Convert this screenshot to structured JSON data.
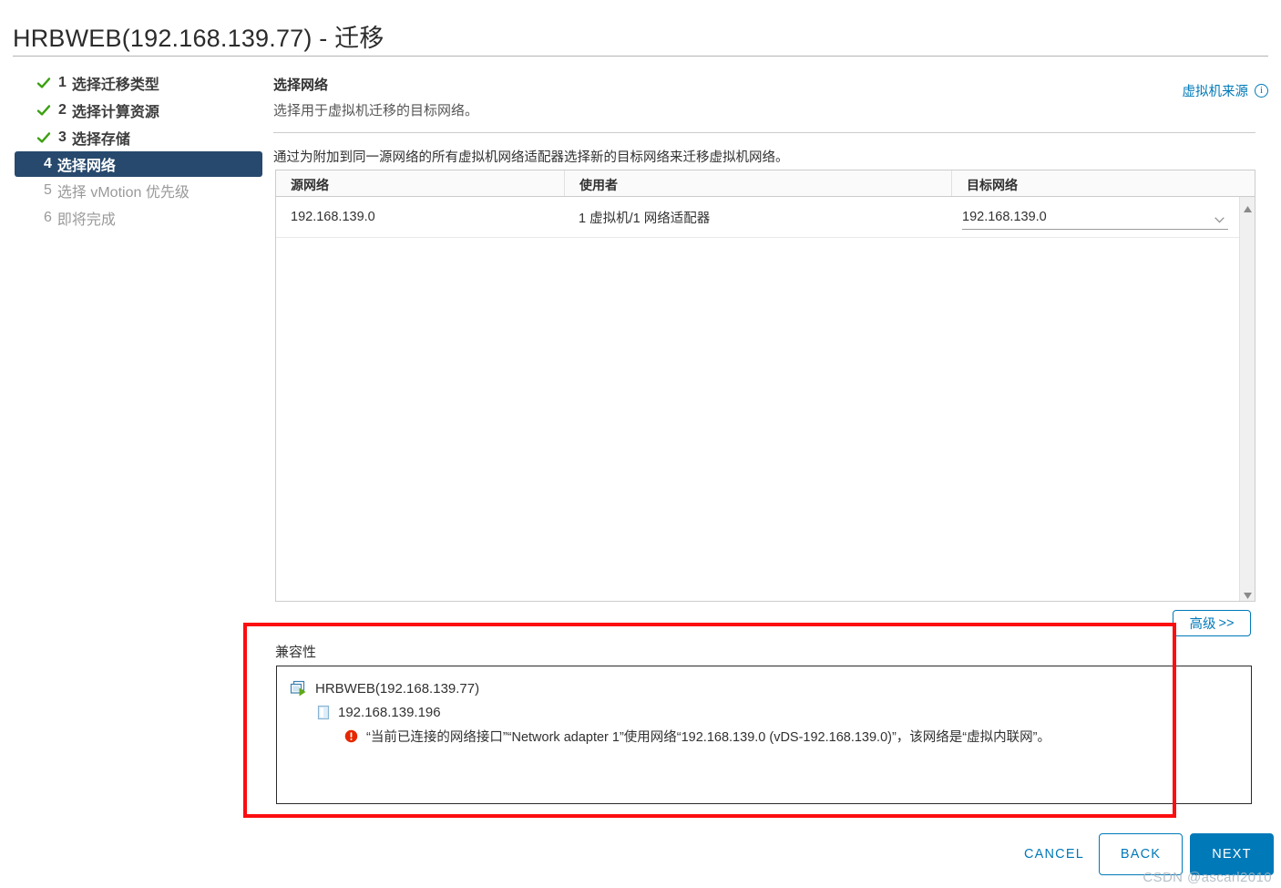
{
  "window": {
    "title": "HRBWEB(192.168.139.77) - 迁移"
  },
  "steps": [
    {
      "index": "1",
      "label": "选择迁移类型",
      "state": "done"
    },
    {
      "index": "2",
      "label": "选择计算资源",
      "state": "done"
    },
    {
      "index": "3",
      "label": "选择存储",
      "state": "done"
    },
    {
      "index": "4",
      "label": "选择网络",
      "state": "active"
    },
    {
      "index": "5",
      "label": "选择 vMotion 优先级",
      "state": "pending"
    },
    {
      "index": "6",
      "label": "即将完成",
      "state": "pending"
    }
  ],
  "panel": {
    "heading": "选择网络",
    "subheading": "选择用于虚拟机迁移的目标网络。",
    "description": "通过为附加到同一源网络的所有虚拟机网络适配器选择新的目标网络来迁移虚拟机网络。",
    "vm_source_link": "虚拟机来源",
    "info_icon_glyph": "i"
  },
  "table": {
    "columns": [
      "源网络",
      "使用者",
      "目标网络"
    ],
    "rows": [
      {
        "source_network": "192.168.139.0",
        "used_by": "1 虚拟机/1 网络适配器",
        "destination_network": "192.168.139.0"
      }
    ]
  },
  "advanced_button": {
    "label": "高级",
    "chevrons": ">>"
  },
  "compatibility": {
    "label": "兼容性",
    "tree": [
      {
        "level": 1,
        "icon": "virtual-machine-icon",
        "text": "HRBWEB(192.168.139.77)"
      },
      {
        "level": 2,
        "icon": "host-icon",
        "text": "192.168.139.196"
      },
      {
        "level": 3,
        "icon": "error-icon",
        "text": "“当前已连接的网络接口”“Network adapter 1”使用网络“192.168.139.0 (vDS-192.168.139.0)”，该网络是“虚拟内联网”。"
      }
    ]
  },
  "footer": {
    "cancel": "CANCEL",
    "back": "BACK",
    "next": "NEXT"
  },
  "watermark": "CSDN @ascarl2010",
  "colors": {
    "accent_blue": "#0079b8",
    "active_step_bg": "#27496d",
    "check_green": "#3aa110",
    "error_red": "#e62700",
    "annotation_red": "#fc0d10"
  }
}
